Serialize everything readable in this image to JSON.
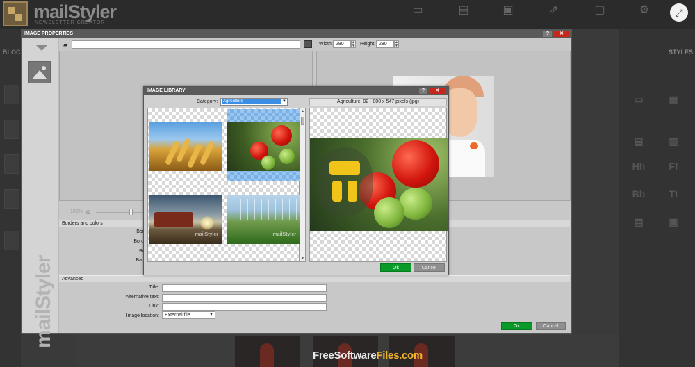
{
  "app": {
    "logo_name": "mailStyler",
    "logo_sub": "NEWSLETTER CREATOR",
    "blocks_label": "BLOCKS",
    "styles_label": "STYLES"
  },
  "image_properties": {
    "title": "IMAGE PROPERTIES",
    "help_label": "?",
    "close_label": "✕",
    "width_label": "Width:",
    "width_value": "280",
    "height_label": "Height:",
    "height_value": "280",
    "zoom_value": "100%",
    "sections": {
      "borders": "Borders and colors",
      "advanced": "Advanced"
    },
    "border_labels": [
      "Bord",
      "Borde",
      "Bor",
      "Back"
    ],
    "fields": {
      "title_label": "Title:",
      "alt_label": "Alternative text:",
      "link_label": "Link:",
      "location_label": "Image location:",
      "location_value": "External file"
    },
    "ok_label": "Ok",
    "cancel_label": "Cancel",
    "side_brand": "mailStyler"
  },
  "image_library": {
    "title": "IMAGE LIBRARY",
    "help_label": "?",
    "close_label": "✕",
    "category_label": "Category:",
    "category_value": "Agriculture",
    "preview_info": "Agriculture_02 - 800 x 547 pixels (jpg)",
    "thumb_watermark": "mailStyler",
    "ok_label": "Ok",
    "cancel_label": "Cancel"
  },
  "overlay": {
    "expand_icon": "⤢",
    "watermark_main": "FreeSoftware",
    "watermark_accent": "Files.com"
  },
  "colors": {
    "ok_green": "#0a9a2a",
    "close_red": "#c8251b",
    "selection_blue": "#3a8ee6"
  }
}
